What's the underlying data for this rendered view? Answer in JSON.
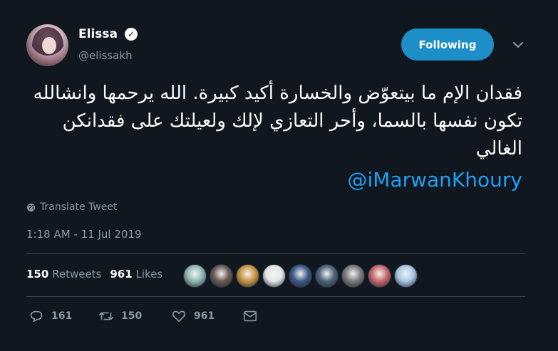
{
  "author": {
    "name": "Elissa",
    "handle": "@elissakh",
    "verified_glyph": "✓"
  },
  "follow_button": {
    "label": "Following",
    "color": "#1d8ec7"
  },
  "tweet": {
    "text": "فقدان الإم ما بيتعوّض والخسارة أكيد كبيرة. الله يرحمها وانشالله تكون نفسها بالسما، وأحر التعازي لإلك ولعيلتك على فقدانكن الغالي",
    "mention": "@iMarwanKhoury"
  },
  "translate_label": "Translate Tweet",
  "timestamp": "1:18 AM - 11 Jul 2019",
  "stats": {
    "retweets_count": "150",
    "retweets_label": "Retweets",
    "likes_count": "961",
    "likes_label": "Likes"
  },
  "liker_avatars": [
    {
      "color": "#8fb9b1"
    },
    {
      "color": "#6a5a55"
    },
    {
      "color": "#c8963f"
    },
    {
      "color": "#e6e6e6"
    },
    {
      "color": "#3d5b88"
    },
    {
      "color": "#4b6478"
    },
    {
      "color": "#7b7b7b"
    },
    {
      "color": "#c7686b"
    },
    {
      "color": "#a9c7e4"
    }
  ],
  "actions": {
    "reply_count": "161",
    "retweet_count": "150",
    "like_count": "961"
  },
  "colors": {
    "background": "#10171e",
    "accent": "#1da1f2",
    "muted": "#8899a6",
    "divider": "#38444d"
  }
}
